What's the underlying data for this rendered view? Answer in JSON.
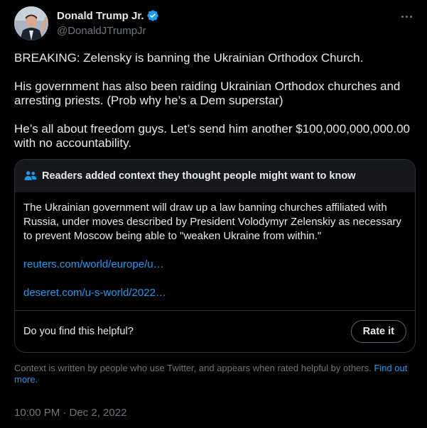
{
  "author": {
    "display_name": "Donald Trump Jr.",
    "handle": "@DonaldJTrumpJr",
    "verified_icon": "verified-badge-icon",
    "verified_color": "#1d9bf0"
  },
  "more_icon": "more-horizontal-icon",
  "tweet": {
    "paragraphs": [
      "BREAKING: Zelensky is banning the Ukrainian Orthodox Church.",
      "His government has also been raiding Ukrainian Orthodox churches and arresting priests. (Prob why he’s a Dem superstar)",
      "He’s all about freedom guys. Let’s send him another $100,000,000,000.00 with no accountability."
    ]
  },
  "community_note": {
    "icon": "people-icon",
    "title": "Readers added context they thought people might want to know",
    "text": "The Ukrainian government will draw up a law banning churches affiliated with Russia, under moves described by President Volodymyr Zelenskiy as necessary to prevent Moscow being able to \"weaken Ukraine from within.\"",
    "links": [
      "reuters.com/world/europe/u…",
      "deseret.com/u-s-world/2022…"
    ],
    "helpful_question": "Do you find this helpful?",
    "rate_button": "Rate it"
  },
  "disclaimer": {
    "text": "Context is written by people who use Twitter, and appears when rated helpful by others.",
    "link": "Find out more."
  },
  "timestamp": "10:00 PM · Dec 2, 2022",
  "colors": {
    "background": "#000000",
    "text": "#e7e9ea",
    "muted": "#71767b",
    "link": "#1d9bf0",
    "border": "#2f3336",
    "note_header_bg": "#16181c"
  }
}
